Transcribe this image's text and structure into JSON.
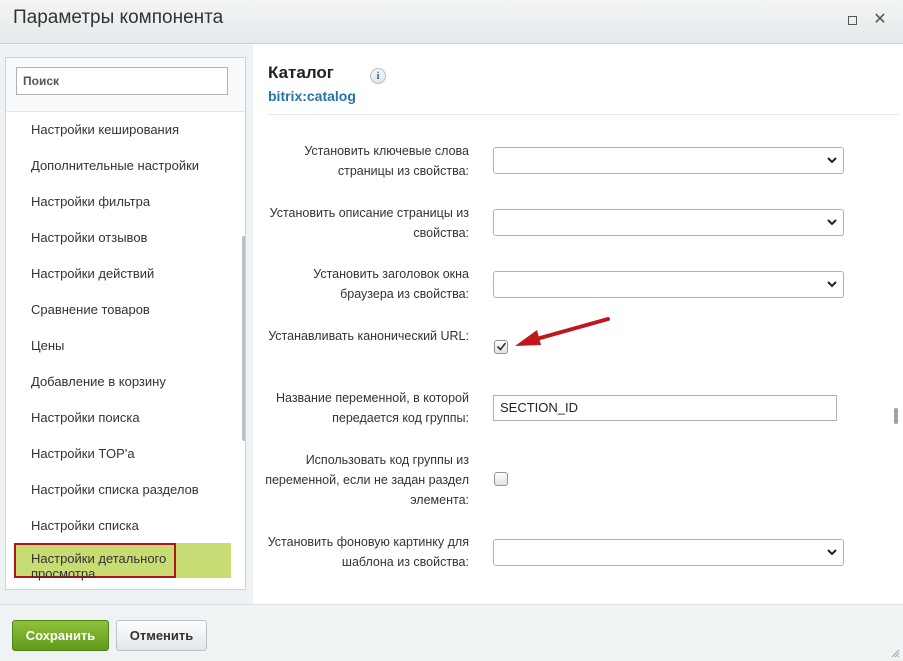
{
  "window": {
    "title": "Параметры компонента"
  },
  "sidebar": {
    "search_placeholder": "Поиск",
    "items": [
      "Настройки кеширования",
      "Дополнительные настройки",
      "Настройки фильтра",
      "Настройки отзывов",
      "Настройки действий",
      "Сравнение товаров",
      "Цены",
      "Добавление в корзину",
      "Настройки поиска",
      "Настройки TOP'a",
      "Настройки списка разделов",
      "Настройки списка"
    ],
    "active_item": "Настройки детального просмотра"
  },
  "component": {
    "title": "Каталог",
    "code": "bitrix:catalog",
    "info_icon": "i"
  },
  "fields": {
    "keywords_label": "Установить ключевые слова страницы из свойства:",
    "keywords_value": "",
    "description_label": "Установить описание страницы из свойства:",
    "description_value": "",
    "browser_title_label": "Установить заголовок окна браузера из свойства:",
    "browser_title_value": "",
    "canonical_label": "Устанавливать канонический URL:",
    "canonical_checked": true,
    "section_var_label": "Название переменной, в которой передается код группы:",
    "section_var_value": "SECTION_ID",
    "use_section_code_label": "Использовать код группы из переменной, если не задан раздел элемента:",
    "use_section_code_checked": false,
    "background_label": "Установить фоновую картинку для шаблона из свойства:",
    "background_value": ""
  },
  "footer": {
    "save_label": "Сохранить",
    "cancel_label": "Отменить"
  },
  "colors": {
    "save_button": "#6aa825",
    "active_item_bg": "#c8dc74",
    "highlight_border": "#b3141b",
    "annotation_arrow": "#c0161d",
    "component_code": "#2675a8"
  }
}
